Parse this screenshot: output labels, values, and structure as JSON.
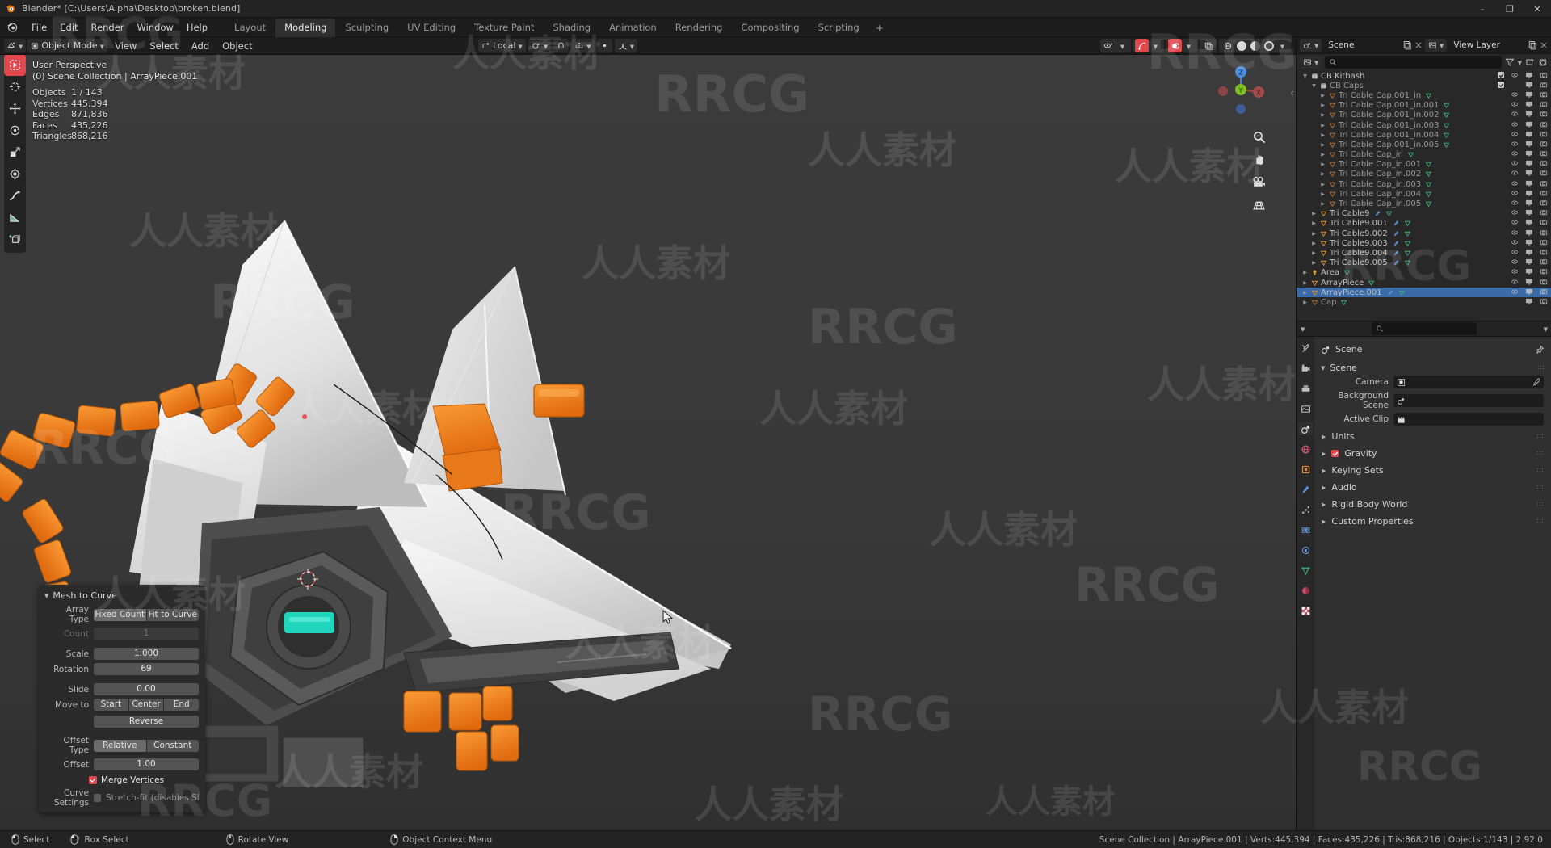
{
  "window": {
    "title": "Blender* [C:\\Users\\Alpha\\Desktop\\broken.blend]",
    "minimize": "–",
    "maximize": "❐",
    "close": "✕"
  },
  "menubar": {
    "items": [
      "File",
      "Edit",
      "Render",
      "Window",
      "Help"
    ]
  },
  "workspaces": {
    "tabs": [
      "Layout",
      "Modeling",
      "Sculpting",
      "UV Editing",
      "Texture Paint",
      "Shading",
      "Animation",
      "Rendering",
      "Compositing",
      "Scripting"
    ],
    "active": "Modeling",
    "add": "+"
  },
  "viewport_header": {
    "editor_icon": "editor-type-icon",
    "mode": "Object Mode",
    "menus": [
      "View",
      "Select",
      "Add",
      "Object"
    ],
    "transform_orientation": "Local",
    "snap_icon": "magnet-icon",
    "proportional_icon": "proportional-edit-icon",
    "right_icons": [
      "visibility-icon",
      "gizmo-icon",
      "overlays-icon",
      "xray-icon",
      "shading-wireframe",
      "shading-solid",
      "shading-material",
      "shading-rendered"
    ]
  },
  "viewport": {
    "perspective_label": "User Perspective",
    "collection_label": "(0) Scene Collection | ArrayPiece.001",
    "stats": [
      {
        "key": "Objects",
        "value": "1 / 143"
      },
      {
        "key": "Vertices",
        "value": "445,394"
      },
      {
        "key": "Edges",
        "value": "871,836"
      },
      {
        "key": "Faces",
        "value": "435,226"
      },
      {
        "key": "Triangles",
        "value": "868,216"
      }
    ],
    "gizmo_axes": [
      "Z",
      "Y",
      "X"
    ],
    "nav_buttons": [
      "zoom-icon",
      "pan-hand-icon",
      "camera-icon",
      "ortho-grid-icon"
    ],
    "toolbar_tools": [
      "tweak-select-tool",
      "cursor-tool",
      "move-tool",
      "rotate-tool",
      "scale-tool",
      "transform-tool",
      "annotate-tool",
      "measure-tool",
      "add-cube-tool"
    ],
    "active_tool": "tweak-select-tool"
  },
  "operator_panel": {
    "title": "Mesh to Curve",
    "rows": [
      {
        "label": "Array Type",
        "type": "segments",
        "options": [
          "Fixed Count",
          "Fit to Curve"
        ],
        "selected": "Fixed Count"
      },
      {
        "label": "Count",
        "type": "field",
        "value": "1",
        "disabled": true
      },
      {
        "label": "Scale",
        "type": "field",
        "value": "1.000"
      },
      {
        "label": "Rotation",
        "type": "field",
        "value": "69"
      },
      {
        "label": "Slide",
        "type": "field",
        "value": "0.00"
      },
      {
        "label": "Move to",
        "type": "segments",
        "options": [
          "Start",
          "Center",
          "End"
        ],
        "selected": ""
      },
      {
        "label": "",
        "type": "button",
        "value": "Reverse"
      },
      {
        "label": "Offset Type",
        "type": "segments",
        "options": [
          "Relative",
          "Constant"
        ],
        "selected": "Relative"
      },
      {
        "label": "Offset",
        "type": "field",
        "value": "1.00"
      }
    ],
    "merge_vertices": {
      "label": "Merge Vertices",
      "checked": true
    },
    "curve_settings": {
      "label": "Curve Settings",
      "option": "Stretch-fit (disables Sli...",
      "checked": false
    }
  },
  "outliner": {
    "scene_name": "Scene",
    "view_layer_name": "View Layer",
    "display_mode_icon": "view-layer-icon",
    "search_placeholder": "",
    "filter_icon": "filter-funnel-icon",
    "rows": [
      {
        "label": "CB Kitbash",
        "indent": 0,
        "icon": "collection-icon",
        "disclosure": "down",
        "checkbox": true,
        "eye": true,
        "screen": true,
        "camera": true,
        "sel": false,
        "dim": false
      },
      {
        "label": "CB Caps",
        "indent": 1,
        "icon": "collection-icon",
        "disclosure": "down",
        "checkbox": true,
        "eye": false,
        "screen": true,
        "camera": true,
        "sel": false,
        "dim": true
      },
      {
        "label": "Tri Cable Cap.001_in",
        "indent": 2,
        "icon": "mesh-icon",
        "disclosure": "right",
        "eye": true,
        "screen": true,
        "camera": true,
        "dim": true,
        "data": true
      },
      {
        "label": "Tri Cable Cap.001_in.001",
        "indent": 2,
        "icon": "mesh-icon",
        "disclosure": "right",
        "eye": true,
        "screen": true,
        "camera": true,
        "dim": true,
        "data": true
      },
      {
        "label": "Tri Cable Cap.001_in.002",
        "indent": 2,
        "icon": "mesh-icon",
        "disclosure": "right",
        "eye": true,
        "screen": true,
        "camera": true,
        "dim": true,
        "data": true
      },
      {
        "label": "Tri Cable Cap.001_in.003",
        "indent": 2,
        "icon": "mesh-icon",
        "disclosure": "right",
        "eye": true,
        "screen": true,
        "camera": true,
        "dim": true,
        "data": true
      },
      {
        "label": "Tri Cable Cap.001_in.004",
        "indent": 2,
        "icon": "mesh-icon",
        "disclosure": "right",
        "eye": true,
        "screen": true,
        "camera": true,
        "dim": true,
        "data": true
      },
      {
        "label": "Tri Cable Cap.001_in.005",
        "indent": 2,
        "icon": "mesh-icon",
        "disclosure": "right",
        "eye": true,
        "screen": true,
        "camera": true,
        "dim": true,
        "data": true
      },
      {
        "label": "Tri Cable Cap_in",
        "indent": 2,
        "icon": "mesh-icon",
        "disclosure": "right",
        "eye": true,
        "screen": true,
        "camera": true,
        "dim": true,
        "data": true
      },
      {
        "label": "Tri Cable Cap_in.001",
        "indent": 2,
        "icon": "mesh-icon",
        "disclosure": "right",
        "eye": true,
        "screen": true,
        "camera": true,
        "dim": true,
        "data": true
      },
      {
        "label": "Tri Cable Cap_in.002",
        "indent": 2,
        "icon": "mesh-icon",
        "disclosure": "right",
        "eye": true,
        "screen": true,
        "camera": true,
        "dim": true,
        "data": true
      },
      {
        "label": "Tri Cable Cap_in.003",
        "indent": 2,
        "icon": "mesh-icon",
        "disclosure": "right",
        "eye": true,
        "screen": true,
        "camera": true,
        "dim": true,
        "data": true
      },
      {
        "label": "Tri Cable Cap_in.004",
        "indent": 2,
        "icon": "mesh-icon",
        "disclosure": "right",
        "eye": true,
        "screen": true,
        "camera": true,
        "dim": true,
        "data": true
      },
      {
        "label": "Tri Cable Cap_in.005",
        "indent": 2,
        "icon": "mesh-icon",
        "disclosure": "right",
        "eye": true,
        "screen": true,
        "camera": true,
        "dim": true,
        "data": true
      },
      {
        "label": "Tri Cable9",
        "indent": 1,
        "icon": "mesh-icon",
        "disclosure": "right",
        "eye": true,
        "screen": true,
        "camera": true,
        "dim": false,
        "wrench": true,
        "data": true
      },
      {
        "label": "Tri Cable9.001",
        "indent": 1,
        "icon": "mesh-icon",
        "disclosure": "right",
        "eye": true,
        "screen": true,
        "camera": true,
        "dim": false,
        "wrench": true,
        "data": true
      },
      {
        "label": "Tri Cable9.002",
        "indent": 1,
        "icon": "mesh-icon",
        "disclosure": "right",
        "eye": true,
        "screen": true,
        "camera": true,
        "dim": false,
        "wrench": true,
        "data": true
      },
      {
        "label": "Tri Cable9.003",
        "indent": 1,
        "icon": "mesh-icon",
        "disclosure": "right",
        "eye": true,
        "screen": true,
        "camera": true,
        "dim": false,
        "wrench": true,
        "data": true
      },
      {
        "label": "Tri Cable9.004",
        "indent": 1,
        "icon": "mesh-icon",
        "disclosure": "right",
        "eye": true,
        "screen": true,
        "camera": true,
        "dim": false,
        "wrench": true,
        "data": true
      },
      {
        "label": "Tri Cable9.005",
        "indent": 1,
        "icon": "mesh-icon",
        "disclosure": "right",
        "eye": true,
        "screen": true,
        "camera": true,
        "dim": false,
        "wrench": true,
        "data": true
      },
      {
        "label": "Area",
        "indent": 0,
        "icon": "light-icon",
        "disclosure": "right",
        "eye": true,
        "screen": true,
        "camera": true,
        "dim": false,
        "data": true
      },
      {
        "label": "ArrayPiece",
        "indent": 0,
        "icon": "mesh-icon",
        "disclosure": "right",
        "eye": true,
        "screen": true,
        "camera": true,
        "dim": false,
        "data": true
      },
      {
        "label": "ArrayPiece.001",
        "indent": 0,
        "icon": "mesh-icon",
        "disclosure": "right",
        "eye": true,
        "screen": true,
        "camera": true,
        "dim": false,
        "sel": true,
        "wrench": true,
        "data": true
      },
      {
        "label": "Cap",
        "indent": 0,
        "icon": "mesh-icon",
        "disclosure": "right",
        "eye": false,
        "screen": true,
        "camera": true,
        "dim": true,
        "data": true
      }
    ]
  },
  "properties": {
    "breadcrumb": "Scene",
    "pin_icon": "pin-icon",
    "panel_title": "Scene",
    "fields": [
      {
        "label": "Camera",
        "icon": "camera-data-icon",
        "value": "",
        "eyedropper": true
      },
      {
        "label": "Background Scene",
        "icon": "scene-icon",
        "value": "",
        "eyedropper": false
      },
      {
        "label": "Active Clip",
        "icon": "movie-clip-icon",
        "value": "",
        "eyedropper": false
      }
    ],
    "sections": [
      {
        "label": "Units",
        "checkbox": null
      },
      {
        "label": "Gravity",
        "checkbox": true
      },
      {
        "label": "Keying Sets",
        "checkbox": null
      },
      {
        "label": "Audio",
        "checkbox": null
      },
      {
        "label": "Rigid Body World",
        "checkbox": null
      },
      {
        "label": "Custom Properties",
        "checkbox": null
      }
    ],
    "tabs": [
      "tool-icon",
      "render-icon",
      "output-icon",
      "view-layer-icon",
      "scene-icon",
      "world-icon",
      "object-icon",
      "modifier-icon",
      "particles-icon",
      "physics-icon",
      "constraints-icon",
      "object-data-icon",
      "material-icon",
      "texture-icon"
    ],
    "active_tab": "scene-icon"
  },
  "statusbar": {
    "hints": [
      {
        "icon": "mouse-left-icon",
        "label": "Select"
      },
      {
        "icon": "mouse-left-drag-icon",
        "label": "Box Select"
      },
      {
        "icon": "mouse-middle-icon",
        "label": "Rotate View"
      },
      {
        "icon": "mouse-right-icon",
        "label": "Object Context Menu"
      }
    ],
    "info": "Scene Collection | ArrayPiece.001 | Verts:445,394 | Faces:435,226 | Tris:868,216 | Objects:1/143 | 2.92.0"
  },
  "watermarks": {
    "latin": "RRCG",
    "chinese": "人人素材"
  },
  "colors": {
    "accent_red": "#e0484e",
    "select_blue": "#3a6aa8",
    "orange_mesh": "#f0811e",
    "teal": "#1fd6bc"
  }
}
